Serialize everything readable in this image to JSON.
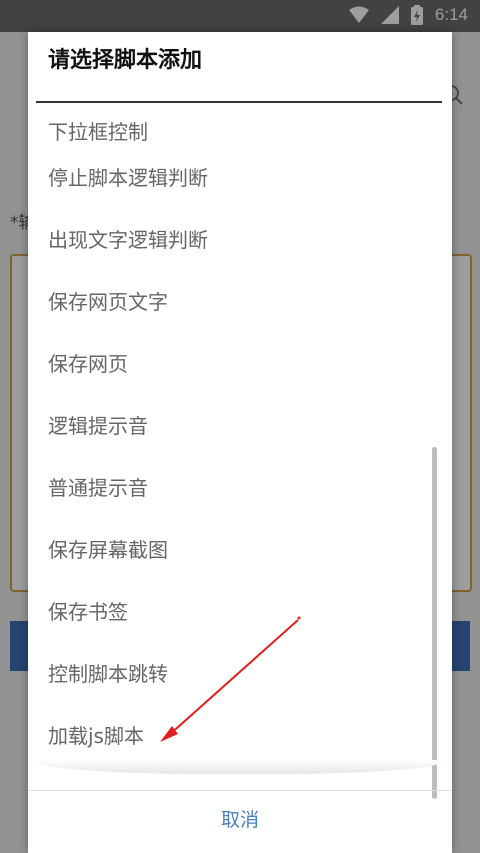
{
  "status_bar": {
    "time": "6:14",
    "icons": [
      "wifi-icon",
      "signal-icon",
      "battery-charging-icon"
    ]
  },
  "background_page": {
    "label_fragment": "*输",
    "accent_color": "#3f6fb5",
    "textarea_border_color": "#c9a24a"
  },
  "dialog": {
    "title": "请选择脚本添加",
    "items": [
      {
        "label": "下拉框控制"
      },
      {
        "label": "停止脚本逻辑判断"
      },
      {
        "label": "出现文字逻辑判断"
      },
      {
        "label": "保存网页文字"
      },
      {
        "label": "保存网页"
      },
      {
        "label": "逻辑提示音"
      },
      {
        "label": "普通提示音"
      },
      {
        "label": "保存屏幕截图"
      },
      {
        "label": "保存书签"
      },
      {
        "label": "控制脚本跳转"
      },
      {
        "label": "加载js脚本"
      }
    ],
    "cancel_label": "取消",
    "cancel_color": "#4a7fc1"
  },
  "annotation": {
    "arrow_color": "#e02020"
  }
}
